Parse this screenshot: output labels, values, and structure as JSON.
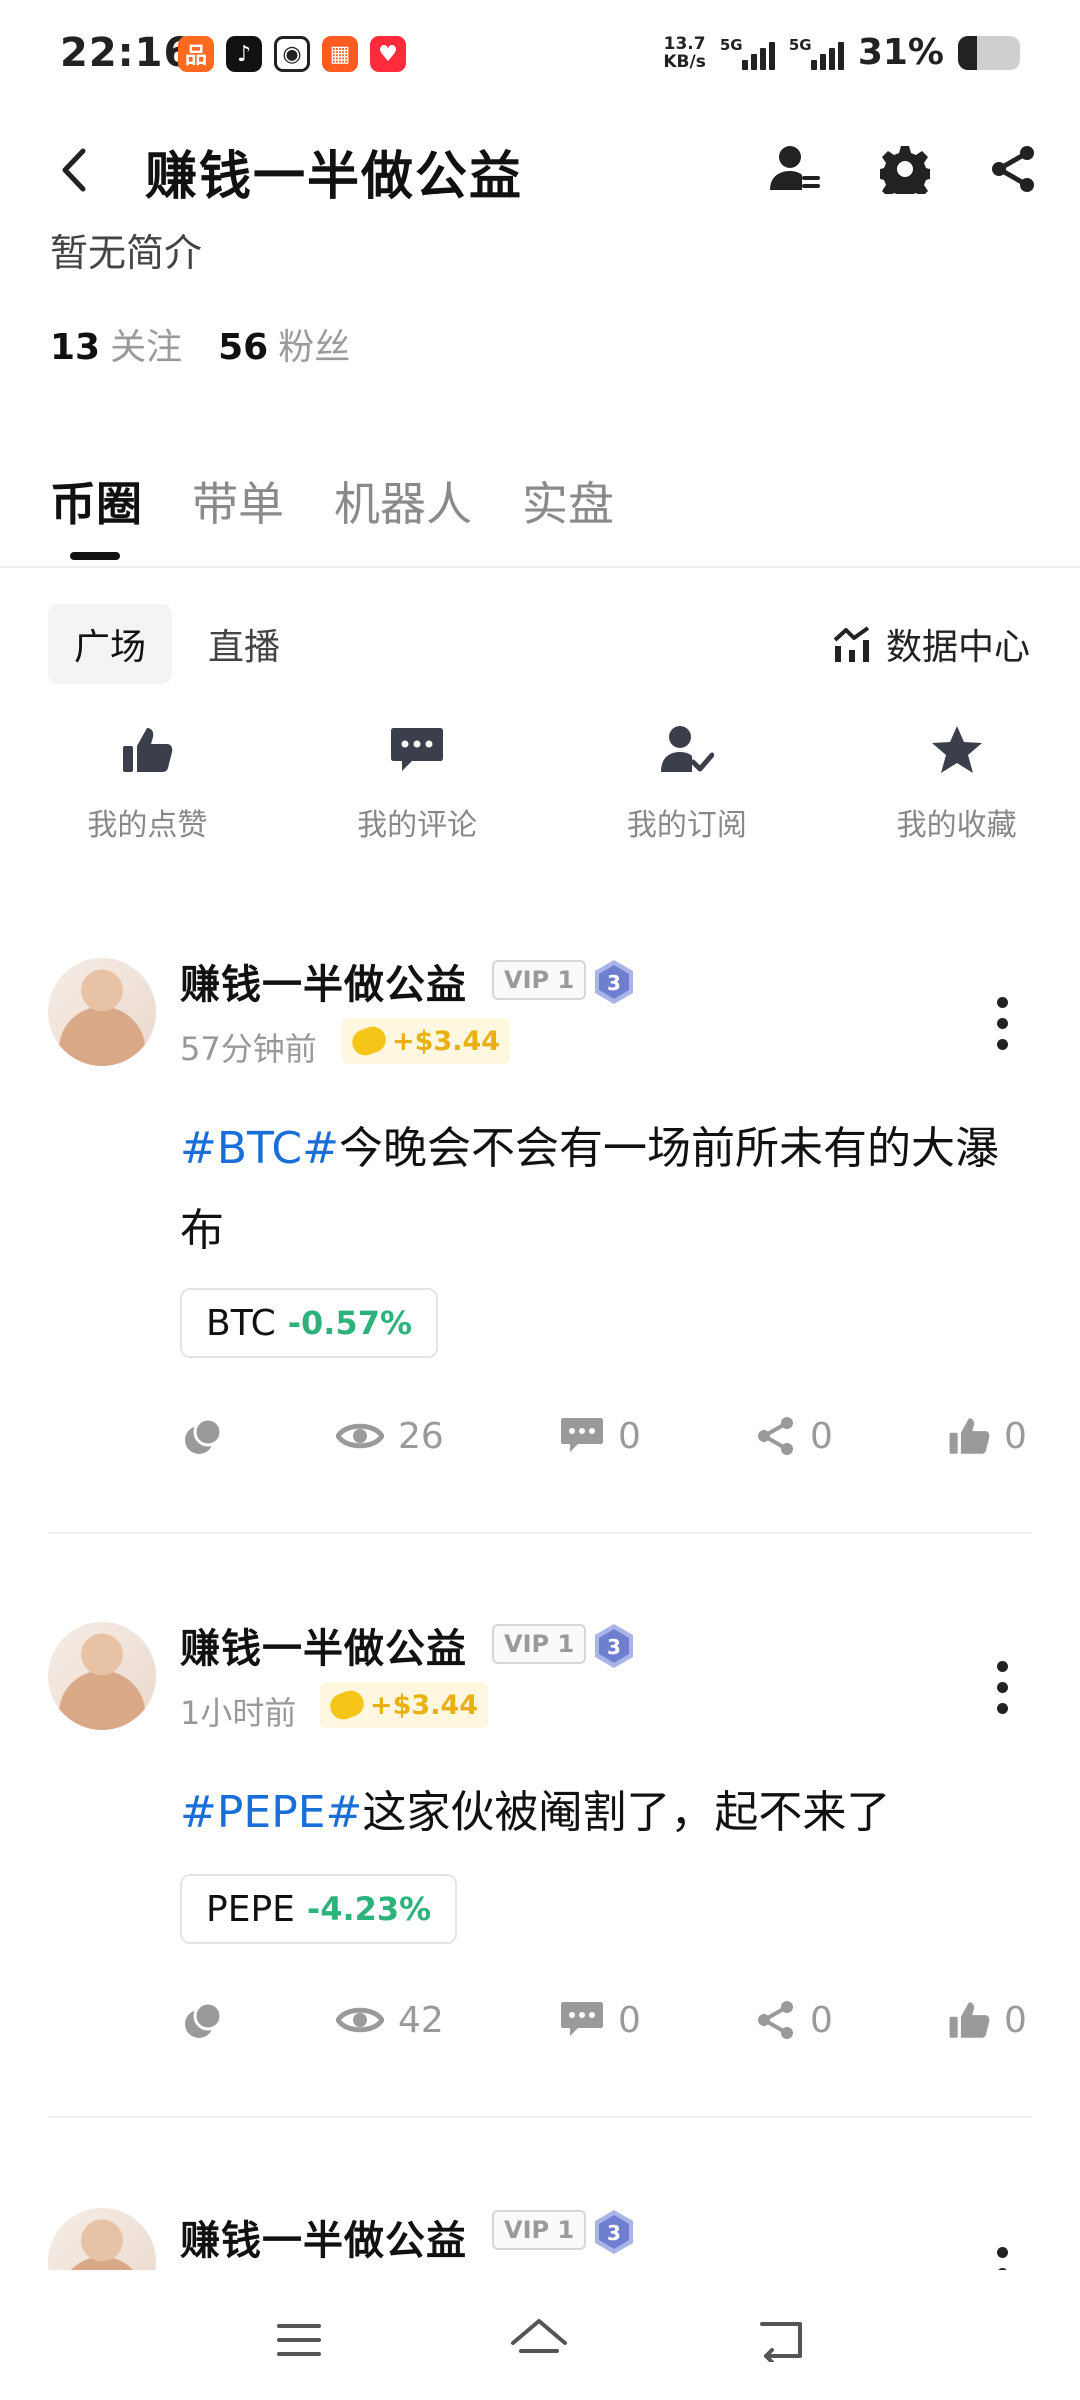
{
  "status_bar": {
    "time": "22:16",
    "net_speed_value": "13.7",
    "net_speed_unit": "KB/s",
    "sim1": "5G",
    "sim2": "5G",
    "battery_text": "31%",
    "battery_level": 0.31
  },
  "header": {
    "title": "赚钱一半做公益",
    "bio": "暂无简介",
    "following_count": "13",
    "following_label": "关注",
    "followers_count": "56",
    "followers_label": "粉丝"
  },
  "main_tabs": [
    "币圈",
    "带单",
    "机器人",
    "实盘"
  ],
  "sub_tabs": [
    "广场",
    "直播"
  ],
  "data_center_label": "数据中心",
  "quick_actions": [
    "我的点赞",
    "我的评论",
    "我的订阅",
    "我的收藏"
  ],
  "posts": [
    {
      "author": "赚钱一半做公益",
      "vip": "VIP 1",
      "level": "3",
      "time": "57分钟前",
      "tip": "+$3.44",
      "hashtag": "#BTC#",
      "text": "今晚会不会有一场前所未有的大瀑布",
      "coin": "BTC",
      "change": "-0.57%",
      "views": "26",
      "comments": "0",
      "shares": "0",
      "likes": "0"
    },
    {
      "author": "赚钱一半做公益",
      "vip": "VIP 1",
      "level": "3",
      "time": "1小时前",
      "tip": "+$3.44",
      "hashtag": "#PEPE#",
      "text": "这家伙被阉割了，起不来了",
      "coin": "PEPE",
      "change": "-4.23%",
      "views": "42",
      "comments": "0",
      "shares": "0",
      "likes": "0"
    },
    {
      "author": "赚钱一半做公益",
      "vip": "VIP 1",
      "level": "3"
    }
  ],
  "colors": {
    "hashtag": "#1a6ed8",
    "change_positive_green": "#2db27c",
    "tip_gold": "#e9b10e"
  }
}
